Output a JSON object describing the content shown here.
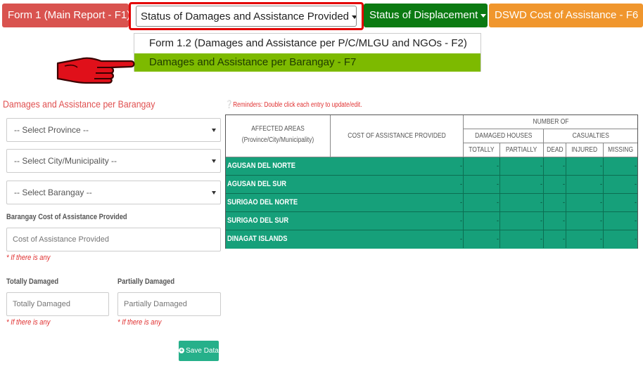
{
  "nav": {
    "tab1": "Form 1 (Main Report - F1)",
    "tab2": "Status of Damages and Assistance Provided",
    "tab3": "Status of Displacement",
    "tab4": "DSWD Cost of Assistance - F6",
    "dropdown_items": [
      "Form 1.2 (Damages and Assistance per P/C/MLGU and NGOs - F2)",
      "Damages and Assistance per Barangay - F7"
    ]
  },
  "colors": {
    "tab1": "#d9534f",
    "tab3": "#0b7a12",
    "tab4": "#f0962d",
    "dropdown_active": "#7dba00",
    "table_row": "#16a07a",
    "highlight_box": "#e30000"
  },
  "form": {
    "title": "Damages and Assistance per Barangay",
    "select_province": "-- Select Province --",
    "select_city": "-- Select City/Municipality --",
    "select_barangay": "-- Select Barangay --",
    "cost_label": "Barangay Cost of Assistance Provided",
    "cost_placeholder": "Cost of Assistance Provided",
    "hint": "* If there is any",
    "totally_label": "Totally Damaged",
    "totally_placeholder": "Totally Damaged",
    "partially_label": "Partially Damaged",
    "partially_placeholder": "Partially Damaged",
    "save_label": "Save Data"
  },
  "reminder": "Reminders: Double click each entry to update/edit.",
  "table": {
    "affected_areas": "AFFECTED AREAS",
    "affected_sub": "(Province/City/Municipality)",
    "cost": "COST OF ASSISTANCE PROVIDED",
    "number_of": "NUMBER OF",
    "damaged_houses": "DAMAGED HOUSES",
    "casualties": "CASUALTIES",
    "totally": "TOTALLY",
    "partially": "PARTIALLY",
    "dead": "DEAD",
    "injured": "INJURED",
    "missing": "MISSING",
    "rows": [
      {
        "name": "AGUSAN DEL NORTE",
        "cost": "-",
        "totally": "-",
        "partially": "-",
        "dead": "-",
        "injured": "-",
        "missing": "-"
      },
      {
        "name": "AGUSAN DEL SUR",
        "cost": "-",
        "totally": "-",
        "partially": "-",
        "dead": "-",
        "injured": "-",
        "missing": "-"
      },
      {
        "name": "SURIGAO DEL NORTE",
        "cost": "-",
        "totally": "-",
        "partially": "-",
        "dead": "-",
        "injured": "-",
        "missing": "-"
      },
      {
        "name": "SURIGAO DEL SUR",
        "cost": "-",
        "totally": "-",
        "partially": "-",
        "dead": "-",
        "injured": "-",
        "missing": "-"
      },
      {
        "name": "DINAGAT ISLANDS",
        "cost": "-",
        "totally": "-",
        "partially": "-",
        "dead": "-",
        "injured": "-",
        "missing": "-"
      }
    ]
  }
}
